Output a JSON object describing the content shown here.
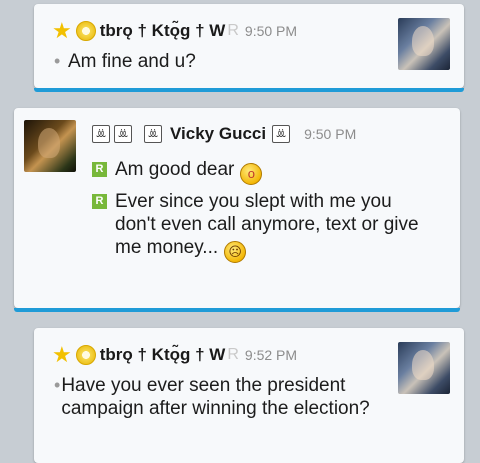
{
  "messages": [
    {
      "sender": "tbrǫ † Ktǫ̃g † W",
      "sender_faded": "R",
      "time": "9:50 PM",
      "lines": [
        "Am fine and u?"
      ]
    },
    {
      "sender_prefix": [
        "ꔣ",
        "ꔣ",
        "ꔣ"
      ],
      "sender": "Vicky Gucci",
      "sender_suffix": "ꔣ",
      "time": "9:50 PM",
      "lines": [
        "Am good dear",
        "Ever since you slept with me you don't even call anymore, text or give me money..."
      ],
      "emojis": [
        "surprised-emoji",
        "sad-emoji"
      ],
      "emoji_glyphs": [
        "o",
        "☹"
      ]
    },
    {
      "sender": "tbrǫ † Ktǫ̃g † W",
      "sender_faded": "R",
      "time": "9:52 PM",
      "lines": [
        "Have you ever seen the president campaign after winning the election?"
      ]
    }
  ],
  "badge_letter": "R",
  "colors": {
    "accent": "#1f9bd7",
    "badge": "#78b83a",
    "star": "#f2c000"
  }
}
